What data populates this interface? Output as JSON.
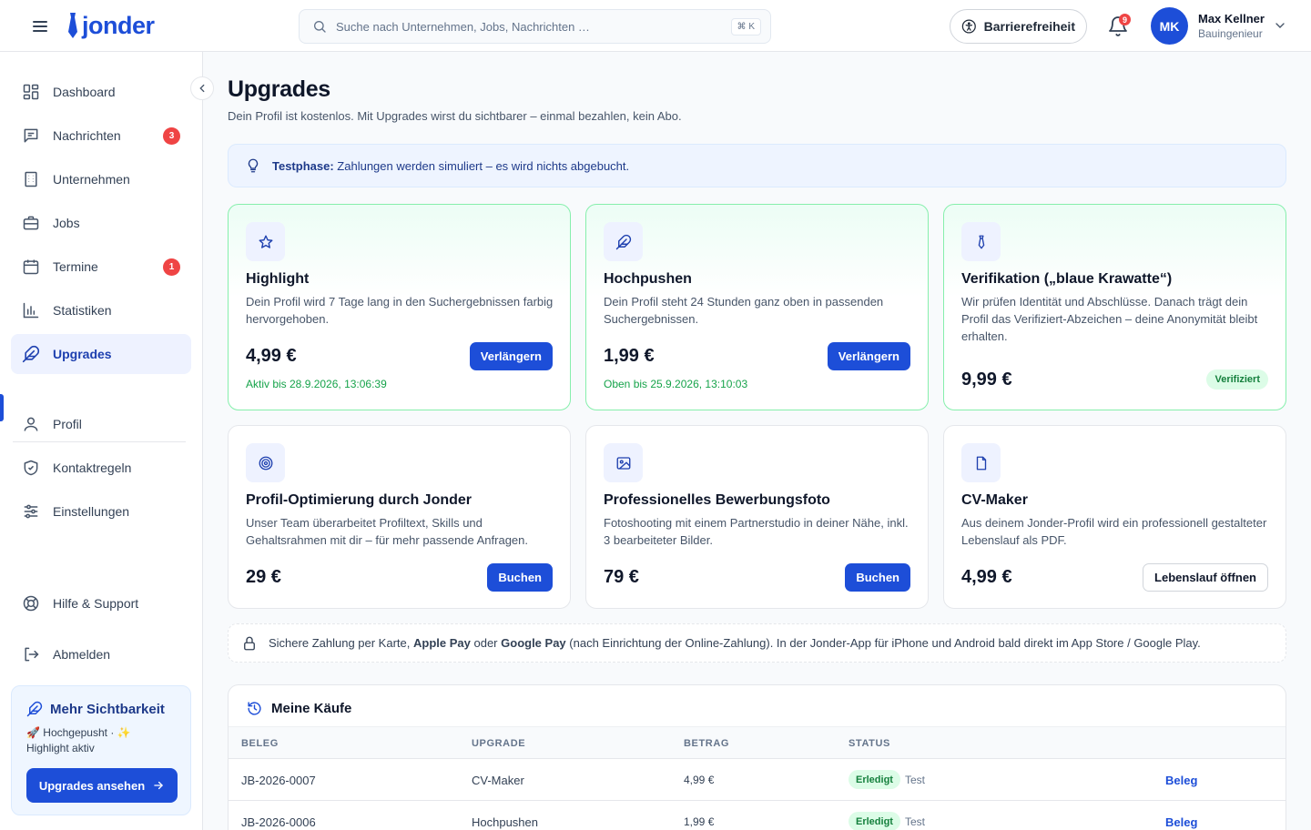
{
  "header": {
    "logo": "jonder",
    "search_placeholder": "Suche nach Unternehmen, Jobs, Nachrichten …",
    "search_shortcut": "⌘ K",
    "accessibility_label": "Barrierefreiheit",
    "notification_count": "9",
    "user": {
      "initials": "MK",
      "name": "Max Kellner",
      "role": "Bauingenieur"
    }
  },
  "sidebar": {
    "items": [
      {
        "label": "Dashboard",
        "icon": "dashboard-icon"
      },
      {
        "label": "Nachrichten",
        "icon": "message-icon",
        "badge": "3"
      },
      {
        "label": "Unternehmen",
        "icon": "building-icon"
      },
      {
        "label": "Jobs",
        "icon": "briefcase-icon"
      },
      {
        "label": "Termine",
        "icon": "calendar-icon",
        "badge": "1"
      },
      {
        "label": "Statistiken",
        "icon": "chart-icon"
      },
      {
        "label": "Upgrades",
        "icon": "feather-icon",
        "active": true
      },
      {
        "label": "Profil",
        "icon": "user-icon"
      },
      {
        "label": "Kontaktregeln",
        "icon": "shield-icon"
      },
      {
        "label": "Einstellungen",
        "icon": "sliders-icon"
      },
      {
        "label": "Hilfe & Support",
        "icon": "lifebuoy-icon"
      },
      {
        "label": "Abmelden",
        "icon": "logout-icon"
      }
    ],
    "promo": {
      "title": "Mehr Sichtbarkeit",
      "text": "🚀 Hochgepusht · ✨ Highlight aktiv",
      "button": "Upgrades ansehen"
    }
  },
  "main": {
    "title": "Upgrades",
    "subtitle": "Dein Profil ist kostenlos. Mit Upgrades wirst du sichtbarer – einmal bezahlen, kein Abo.",
    "notice": {
      "bold": "Testphase:",
      "text": "Zahlungen werden simuliert – es wird nichts abgebucht."
    },
    "cards": [
      {
        "title": "Highlight",
        "desc": "Dein Profil wird 7 Tage lang in den Suchergebnissen farbig hervorgehoben.",
        "price": "4,99 €",
        "button": "Verlängern",
        "status": "Aktiv bis 28.9.2026, 13:06:39",
        "icon": "star-icon"
      },
      {
        "title": "Hochpushen",
        "desc": "Dein Profil steht 24 Stunden ganz oben in passenden Suchergebnissen.",
        "price": "1,99 €",
        "button": "Verlängern",
        "status": "Oben bis 25.9.2026, 13:10:03",
        "icon": "feather-icon"
      },
      {
        "title": "Verifikation („blaue Krawatte“)",
        "desc": "Wir prüfen Identität und Abschlüsse. Danach trägt dein Profil das Verifiziert-Abzeichen – deine Anonymität bleibt erhalten.",
        "price": "9,99 €",
        "badge": "Verifiziert",
        "icon": "tie-icon"
      },
      {
        "title": "Profil-Optimierung durch Jonder",
        "desc": "Unser Team überarbeitet Profiltext, Skills und Gehaltsrahmen mit dir – für mehr passende Anfragen.",
        "price": "29 €",
        "button": "Buchen",
        "icon": "target-icon"
      },
      {
        "title": "Professionelles Bewerbungsfoto",
        "desc": "Fotoshooting mit einem Partnerstudio in deiner Nähe, inkl. 3 bearbeiteter Bilder.",
        "price": "79 €",
        "button": "Buchen",
        "icon": "image-icon"
      },
      {
        "title": "CV-Maker",
        "desc": "Aus deinem Jonder-Profil wird ein professionell gestalteter Lebenslauf als PDF.",
        "price": "4,99 €",
        "button": "Lebenslauf öffnen",
        "icon": "file-icon"
      }
    ],
    "secure": {
      "t1": "Sichere Zahlung per Karte,",
      "b1": "Apple Pay",
      "t2": "oder",
      "b2": "Google Pay",
      "t3": "(nach Einrichtung der Online-Zahlung). In der Jonder-App für iPhone und Android bald direkt im App Store / Google Play."
    },
    "purchases": {
      "title": "Meine Käufe",
      "columns": [
        "BELEG",
        "UPGRADE",
        "BETRAG",
        "STATUS"
      ],
      "rows": [
        {
          "beleg": "JB-2026-0007",
          "upgrade": "CV-Maker",
          "betrag": "4,99 €",
          "status": "Erledigt",
          "note": "Test",
          "link": "Beleg"
        },
        {
          "beleg": "JB-2026-0006",
          "upgrade": "Hochpushen",
          "betrag": "1,99 €",
          "status": "Erledigt",
          "note": "Test",
          "link": "Beleg"
        }
      ]
    }
  },
  "colors": {
    "brand": "#1d4ed8",
    "badge_red": "#ef4444",
    "success": "#16a34a"
  }
}
